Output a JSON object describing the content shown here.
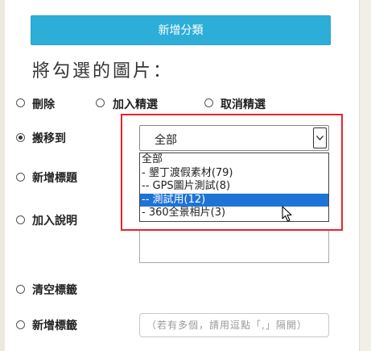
{
  "add_category_button": "新增分類",
  "heading": "將勾選的圖片：",
  "actions": {
    "delete": "刪除",
    "add_featured": "加入精選",
    "remove_featured": "取消精選",
    "move_to": "搬移到",
    "add_title": "新增標題",
    "add_description": "加入說明",
    "clear_tags": "清空標籤",
    "add_tags": "新增標籤"
  },
  "move_select": {
    "value": "全部",
    "options": [
      {
        "label": "全部",
        "selected": false
      },
      {
        "label": "- 墾丁渡假素材(79)",
        "selected": false
      },
      {
        "label": "-- GPS圖片測試(8)",
        "selected": false
      },
      {
        "label": "-- 測試用(12)",
        "selected": true
      },
      {
        "label": "- 360全景相片(3)",
        "selected": false
      }
    ]
  },
  "tags_placeholder": "（若有多個，請用逗點「,」隔開）",
  "selected_action": "move_to"
}
